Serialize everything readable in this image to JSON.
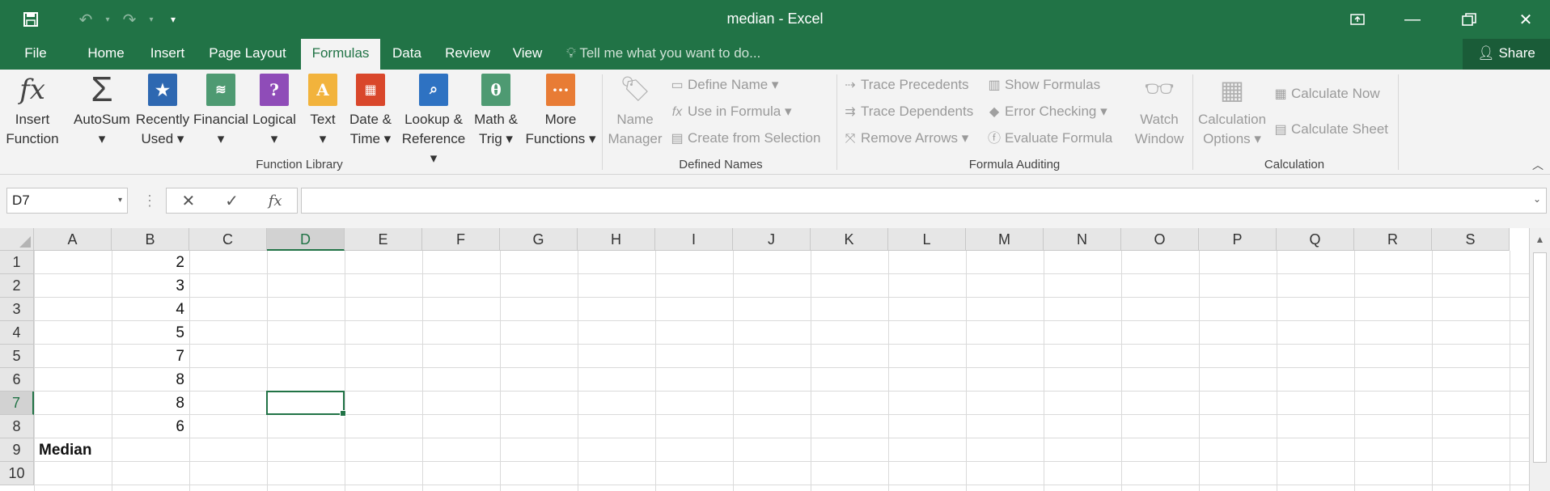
{
  "app": {
    "title": "median - Excel"
  },
  "quick_access": {
    "save_icon": "save-icon",
    "undo_icon": "undo-icon",
    "redo_icon": "redo-icon",
    "customize_icon": "customize-icon"
  },
  "window": {
    "ribbon_display_icon": "ribbon-display-icon",
    "minimize_icon": "minimize-icon",
    "restore_icon": "restore-icon",
    "close_icon": "close-icon"
  },
  "tabs": [
    {
      "label": "File"
    },
    {
      "label": "Home"
    },
    {
      "label": "Insert"
    },
    {
      "label": "Page Layout"
    },
    {
      "label": "Formulas"
    },
    {
      "label": "Data"
    },
    {
      "label": "Review"
    },
    {
      "label": "View"
    }
  ],
  "active_tab": "Formulas",
  "tell_me": "Tell me what you want to do...",
  "share_label": "Share",
  "ribbon": {
    "function_library": {
      "label": "Function Library",
      "insert_function": [
        "Insert",
        "Function"
      ],
      "autosum": [
        "AutoSum",
        "▾"
      ],
      "recently_used": [
        "Recently",
        "Used ▾"
      ],
      "financial": [
        "Financial",
        "▾"
      ],
      "logical": [
        "Logical",
        "▾"
      ],
      "text": [
        "Text",
        "▾"
      ],
      "date_time": [
        "Date &",
        "Time ▾"
      ],
      "lookup_reference": [
        "Lookup &",
        "Reference ▾"
      ],
      "math_trig": [
        "Math &",
        "Trig ▾"
      ],
      "more_functions": [
        "More",
        "Functions ▾"
      ]
    },
    "defined_names": {
      "label": "Defined Names",
      "name_manager": [
        "Name",
        "Manager"
      ],
      "define_name": "Define Name ▾",
      "use_in_formula": "Use in Formula ▾",
      "create_from_selection": "Create from Selection"
    },
    "formula_auditing": {
      "label": "Formula Auditing",
      "trace_precedents": "Trace Precedents",
      "trace_dependents": "Trace Dependents",
      "remove_arrows": "Remove Arrows ▾",
      "show_formulas": "Show Formulas",
      "error_checking": "Error Checking ▾",
      "evaluate_formula": "Evaluate Formula",
      "watch_window": [
        "Watch",
        "Window"
      ]
    },
    "calculation": {
      "label": "Calculation",
      "calculation_options": [
        "Calculation",
        "Options ▾"
      ],
      "calculate_now": "Calculate Now",
      "calculate_sheet": "Calculate Sheet"
    }
  },
  "formula_bar": {
    "name_box": "D7",
    "formula": ""
  },
  "columns": [
    "A",
    "B",
    "C",
    "D",
    "E",
    "F",
    "G",
    "H",
    "I",
    "J",
    "K",
    "L",
    "M",
    "N",
    "O",
    "P",
    "Q",
    "R",
    "S"
  ],
  "rows": [
    "1",
    "2",
    "3",
    "4",
    "5",
    "6",
    "7",
    "8",
    "9",
    "10"
  ],
  "selected_cell": "D7",
  "cells": {
    "B1": "2",
    "B2": "3",
    "B3": "4",
    "B4": "5",
    "B5": "7",
    "B6": "8",
    "B7": "8",
    "B8": "6",
    "A9": "Median"
  }
}
